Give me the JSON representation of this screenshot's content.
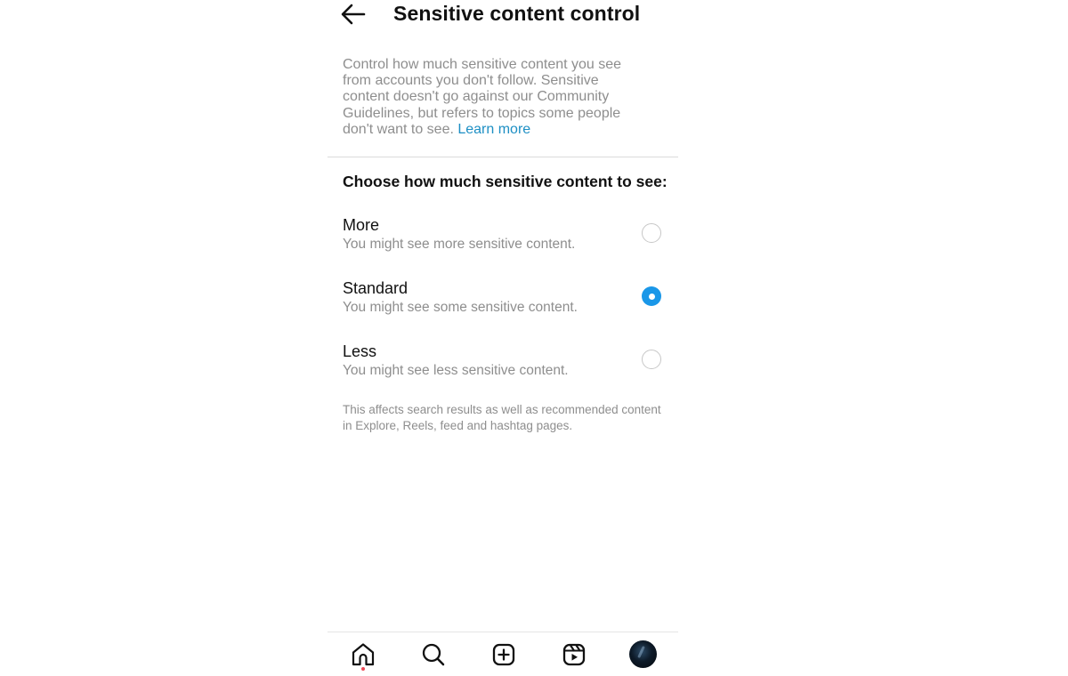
{
  "header": {
    "title": "Sensitive content control",
    "back_icon": "arrow-left-icon"
  },
  "description": {
    "text": "Control how much sensitive content you see from accounts you don't follow. Sensitive content doesn't go against our Community Guidelines, but refers to topics some people don't want to see.",
    "link_label": "Learn more",
    "link_color": "#1d8fc4"
  },
  "section": {
    "heading": "Choose how much sensitive content to see:"
  },
  "options": [
    {
      "title": "More",
      "subtitle": "You might see more sensitive content.",
      "selected": false
    },
    {
      "title": "Standard",
      "subtitle": "You might see some sensitive content.",
      "selected": true
    },
    {
      "title": "Less",
      "subtitle": "You might see less sensitive content.",
      "selected": false
    }
  ],
  "footnote": "This affects search results as well as recommended content in Explore, Reels, feed and hashtag pages.",
  "bottom_nav": {
    "items": [
      {
        "icon": "home-icon",
        "has_notification_dot": true
      },
      {
        "icon": "search-icon"
      },
      {
        "icon": "create-post-icon"
      },
      {
        "icon": "reels-icon"
      },
      {
        "icon": "profile-avatar"
      }
    ]
  },
  "colors": {
    "accent": "#1a97e8",
    "secondary_text": "#8e8e8e",
    "notification_dot": "#ed4956"
  }
}
